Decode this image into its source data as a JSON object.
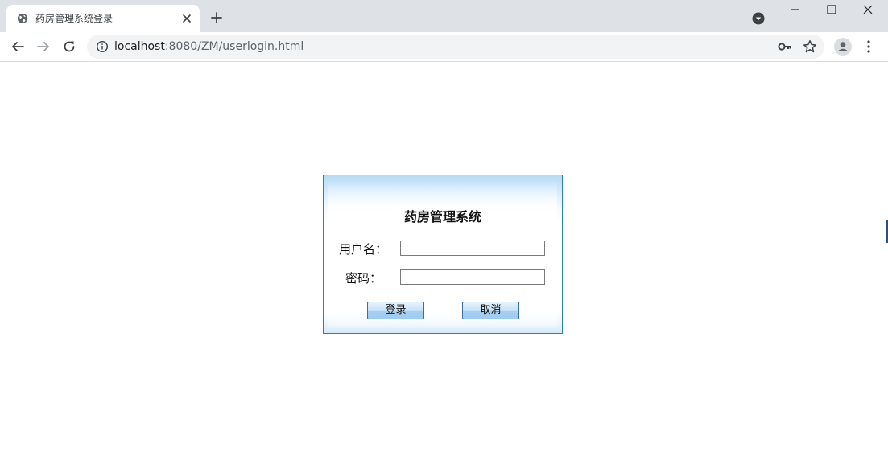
{
  "browser": {
    "tab": {
      "title": "药房管理系统登录",
      "favicon": "globe-icon"
    },
    "address_bar": {
      "host": "localhost",
      "path": ":8080/ZM/userlogin.html"
    },
    "icons": {
      "tab_close": "close-icon",
      "new_tab": "plus-icon",
      "tab_search": "tab-search-icon",
      "minimize": "minimize-icon",
      "maximize": "maximize-icon",
      "close_window": "close-icon",
      "back": "arrow-left-icon",
      "forward": "arrow-right-icon",
      "reload": "reload-icon",
      "site_info": "info-icon",
      "password_key": "key-icon",
      "bookmark": "star-icon",
      "profile": "profile-icon",
      "menu": "kebab-menu-icon"
    }
  },
  "login": {
    "title": "药房管理系统",
    "username_label": "用户名：",
    "username_value": "",
    "password_label": "密码：",
    "password_value": "",
    "login_button": "登录",
    "cancel_button": "取消"
  },
  "colors": {
    "chrome_tab_strip": "#dee1e6",
    "omnibox": "#f1f3f4",
    "login_border": "#2a7fb5",
    "login_header": "#b4dcf6",
    "button_gradient_bottom": "#9ccbf2"
  }
}
